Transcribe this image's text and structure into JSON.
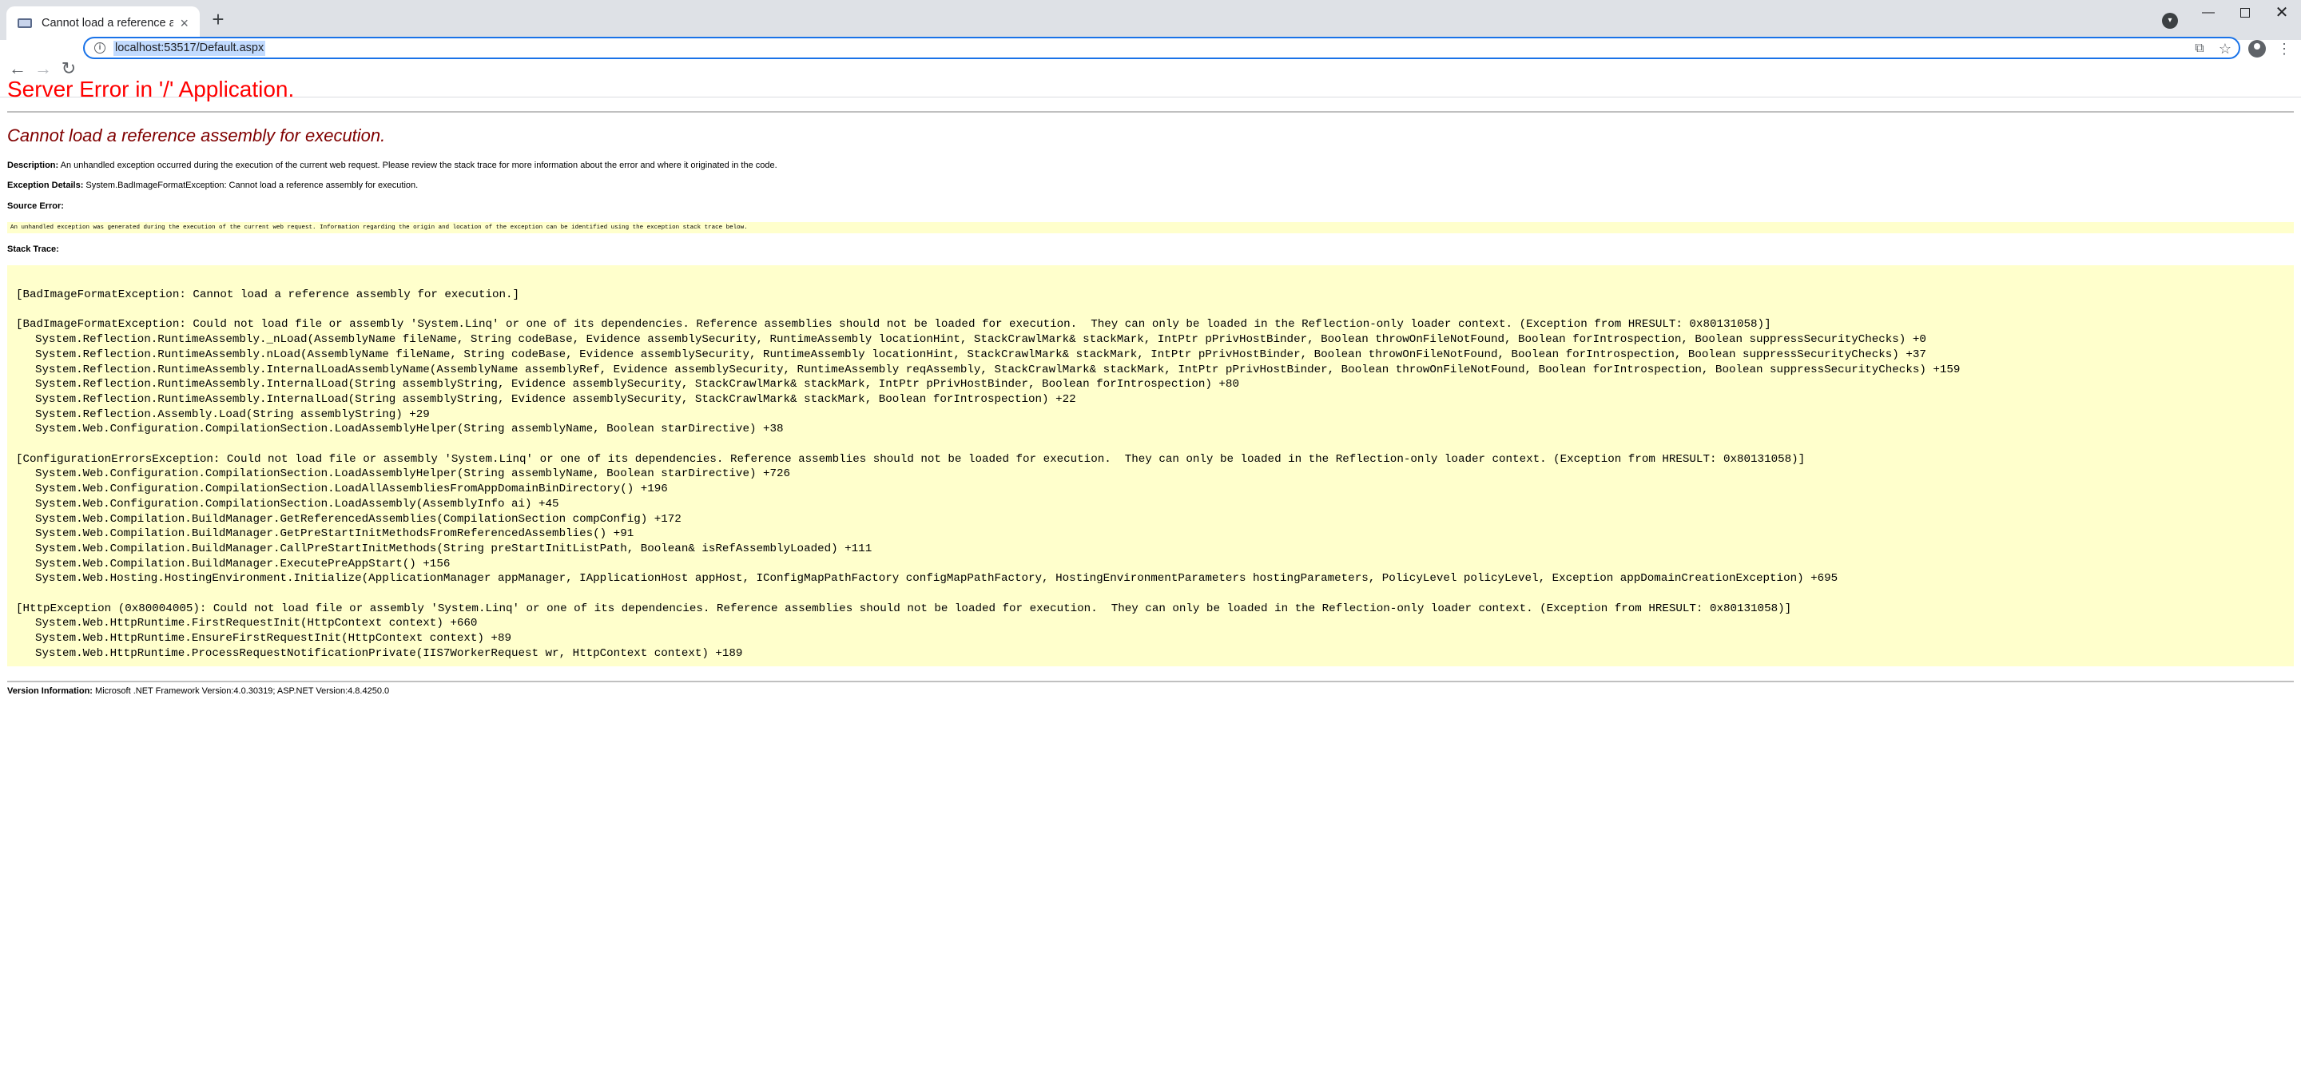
{
  "browser": {
    "tab_title": "Cannot load a reference assembly for execution.",
    "url": "localhost:53517/Default.aspx",
    "new_tab_glyph": "+",
    "close_glyph": "×"
  },
  "page": {
    "server_title": "Server Error in '/' Application.",
    "error_title": "Cannot load a reference assembly for execution.",
    "description_label": "Description:",
    "description_text": "An unhandled exception occurred during the execution of the current web request. Please review the stack trace for more information about the error and where it originated in the code.",
    "exception_label": "Exception Details:",
    "exception_text": "System.BadImageFormatException: Cannot load a reference assembly for execution.",
    "source_error_label": "Source Error:",
    "source_error_text": "An unhandled exception was generated during the execution of the current web request. Information regarding the origin and location of the exception can be identified using the exception stack trace below.",
    "stack_trace_label": "Stack Trace:",
    "stack_blocks": [
      {
        "header": "[BadImageFormatException: Cannot load a reference assembly for execution.]",
        "frames": []
      },
      {
        "header": "[BadImageFormatException: Could not load file or assembly 'System.Linq' or one of its dependencies. Reference assemblies should not be loaded for execution.  They can only be loaded in the Reflection-only loader context. (Exception from HRESULT: 0x80131058)]",
        "frames": [
          "System.Reflection.RuntimeAssembly._nLoad(AssemblyName fileName, String codeBase, Evidence assemblySecurity, RuntimeAssembly locationHint, StackCrawlMark& stackMark, IntPtr pPrivHostBinder, Boolean throwOnFileNotFound, Boolean forIntrospection, Boolean suppressSecurityChecks) +0",
          "System.Reflection.RuntimeAssembly.nLoad(AssemblyName fileName, String codeBase, Evidence assemblySecurity, RuntimeAssembly locationHint, StackCrawlMark& stackMark, IntPtr pPrivHostBinder, Boolean throwOnFileNotFound, Boolean forIntrospection, Boolean suppressSecurityChecks) +37",
          "System.Reflection.RuntimeAssembly.InternalLoadAssemblyName(AssemblyName assemblyRef, Evidence assemblySecurity, RuntimeAssembly reqAssembly, StackCrawlMark& stackMark, IntPtr pPrivHostBinder, Boolean throwOnFileNotFound, Boolean forIntrospection, Boolean suppressSecurityChecks) +159",
          "System.Reflection.RuntimeAssembly.InternalLoad(String assemblyString, Evidence assemblySecurity, StackCrawlMark& stackMark, IntPtr pPrivHostBinder, Boolean forIntrospection) +80",
          "System.Reflection.RuntimeAssembly.InternalLoad(String assemblyString, Evidence assemblySecurity, StackCrawlMark& stackMark, Boolean forIntrospection) +22",
          "System.Reflection.Assembly.Load(String assemblyString) +29",
          "System.Web.Configuration.CompilationSection.LoadAssemblyHelper(String assemblyName, Boolean starDirective) +38"
        ]
      },
      {
        "header": "[ConfigurationErrorsException: Could not load file or assembly 'System.Linq' or one of its dependencies. Reference assemblies should not be loaded for execution.  They can only be loaded in the Reflection-only loader context. (Exception from HRESULT: 0x80131058)]",
        "frames": [
          "System.Web.Configuration.CompilationSection.LoadAssemblyHelper(String assemblyName, Boolean starDirective) +726",
          "System.Web.Configuration.CompilationSection.LoadAllAssembliesFromAppDomainBinDirectory() +196",
          "System.Web.Configuration.CompilationSection.LoadAssembly(AssemblyInfo ai) +45",
          "System.Web.Compilation.BuildManager.GetReferencedAssemblies(CompilationSection compConfig) +172",
          "System.Web.Compilation.BuildManager.GetPreStartInitMethodsFromReferencedAssemblies() +91",
          "System.Web.Compilation.BuildManager.CallPreStartInitMethods(String preStartInitListPath, Boolean& isRefAssemblyLoaded) +111",
          "System.Web.Compilation.BuildManager.ExecutePreAppStart() +156",
          "System.Web.Hosting.HostingEnvironment.Initialize(ApplicationManager appManager, IApplicationHost appHost, IConfigMapPathFactory configMapPathFactory, HostingEnvironmentParameters hostingParameters, PolicyLevel policyLevel, Exception appDomainCreationException) +695"
        ]
      },
      {
        "header": "[HttpException (0x80004005): Could not load file or assembly 'System.Linq' or one of its dependencies. Reference assemblies should not be loaded for execution.  They can only be loaded in the Reflection-only loader context. (Exception from HRESULT: 0x80131058)]",
        "frames": [
          "System.Web.HttpRuntime.FirstRequestInit(HttpContext context) +660",
          "System.Web.HttpRuntime.EnsureFirstRequestInit(HttpContext context) +89",
          "System.Web.HttpRuntime.ProcessRequestNotificationPrivate(IIS7WorkerRequest wr, HttpContext context) +189"
        ]
      }
    ],
    "version_label": "Version Information:",
    "version_text": "Microsoft .NET Framework Version:4.0.30319; ASP.NET Version:4.8.4250.0"
  }
}
